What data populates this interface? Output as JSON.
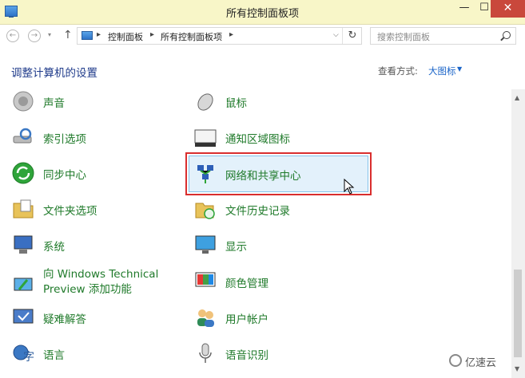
{
  "window": {
    "title": "所有控制面板项",
    "minimize": "—",
    "maximize": "☐",
    "close": "✕"
  },
  "nav": {
    "back": "←",
    "forward": "→",
    "recent": "▾",
    "up": "↑",
    "breadcrumbs": [
      "控制面板",
      "所有控制面板项"
    ],
    "separator": "▸",
    "address_dropdown": "⌵",
    "refresh": "↻",
    "search_placeholder": "搜索控制面板"
  },
  "header": {
    "title": "调整计算机的设置",
    "view_label": "查看方式:",
    "view_value": "大图标",
    "view_caret": "▼"
  },
  "items": [
    {
      "label": "声音",
      "icon": "speaker-icon"
    },
    {
      "label": "鼠标",
      "icon": "mouse-icon"
    },
    {
      "label": "索引选项",
      "icon": "indexing-icon"
    },
    {
      "label": "通知区域图标",
      "icon": "notification-tray-icon"
    },
    {
      "label": "同步中心",
      "icon": "sync-icon"
    },
    {
      "label": "网络和共享中心",
      "icon": "network-icon"
    },
    {
      "label": "文件夹选项",
      "icon": "folder-options-icon"
    },
    {
      "label": "文件历史记录",
      "icon": "file-history-icon"
    },
    {
      "label": "系统",
      "icon": "system-icon"
    },
    {
      "label": "显示",
      "icon": "display-icon"
    },
    {
      "label": "向 Windows Technical Preview 添加功能",
      "icon": "add-features-icon"
    },
    {
      "label": "颜色管理",
      "icon": "color-management-icon"
    },
    {
      "label": "疑难解答",
      "icon": "troubleshooting-icon"
    },
    {
      "label": "用户帐户",
      "icon": "user-accounts-icon"
    },
    {
      "label": "语言",
      "icon": "language-icon"
    },
    {
      "label": "语音识别",
      "icon": "microphone-icon"
    }
  ],
  "scrollbar": {
    "up": "▲",
    "down": "▼"
  },
  "watermark": "亿速云",
  "colors": {
    "title_bar": "#f8f6c8",
    "link_green": "#1f7a2a",
    "highlight": "#e3f1fb",
    "callout_red": "#d92e2e",
    "close_red": "#c9483c"
  }
}
